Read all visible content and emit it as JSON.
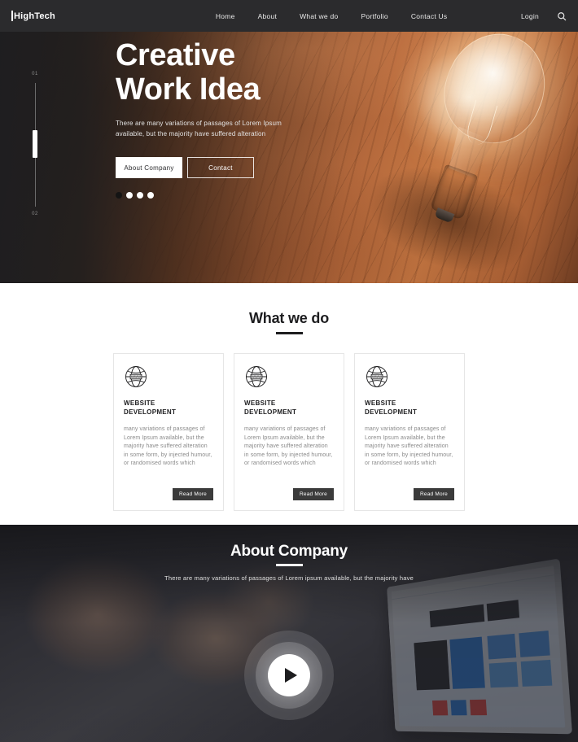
{
  "header": {
    "logo_text": "HighTech",
    "nav": [
      {
        "label": "Home"
      },
      {
        "label": "About"
      },
      {
        "label": "What we do"
      },
      {
        "label": "Portfolio"
      },
      {
        "label": "Contact Us"
      }
    ],
    "login_label": "Login",
    "search_icon": "search-icon"
  },
  "hero": {
    "title_line1": "Creative",
    "title_line2": "Work Idea",
    "subtitle": "There are many variations of passages of Lorem Ipsum available, but the majority have suffered alteration",
    "buttons": {
      "primary": "About Company",
      "secondary": "Contact"
    },
    "slider": {
      "current": "01",
      "total": "02"
    },
    "dots": 4,
    "active_dot": 0
  },
  "services": {
    "title": "What we do",
    "cards": [
      {
        "icon": "globe-www-icon",
        "title_line1": "WEBSITE",
        "title_line2": "DEVELOPMENT",
        "body": "many variations of passages of Lorem Ipsum available, but the majority have suffered alteration in some form, by injected humour, or randomised words which",
        "button": "Read More"
      },
      {
        "icon": "globe-www-icon",
        "title_line1": "WEBSITE",
        "title_line2": "DEVELOPMENT",
        "body": "many variations of passages of Lorem Ipsum available, but the majority have suffered alteration in some form, by injected humour, or randomised words which",
        "button": "Read More"
      },
      {
        "icon": "globe-www-icon",
        "title_line1": "WEBSITE",
        "title_line2": "DEVELOPMENT",
        "body": "many variations of passages of Lorem Ipsum available, but the majority have suffered alteration in some form, by injected humour, or randomised words which",
        "button": "Read More"
      }
    ]
  },
  "about": {
    "title": "About Company",
    "subtitle": "There are many variations of passages of Lorem ipsum available, but the majority have",
    "play_icon": "play-icon"
  },
  "colors": {
    "header_bg": "#2b2b2d",
    "dark_text": "#1d1d1f",
    "muted_text": "#8a8a8a",
    "button_dark": "#3b3b3b",
    "white": "#ffffff"
  }
}
